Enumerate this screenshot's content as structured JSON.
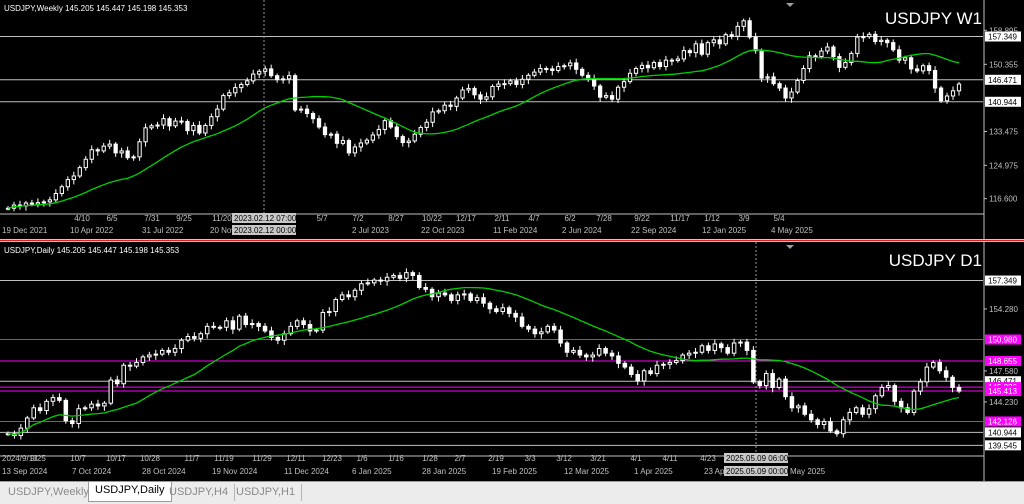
{
  "tabs": [
    "USDJPY,Weekly",
    "USDJPY,Daily",
    "USDJPY,H4",
    "USDJPY,H1"
  ],
  "active_tab": 1,
  "chart_data": [
    {
      "type": "candlestick",
      "panel": "weekly",
      "info": "USDJPY,Weekly  145.205 145.447 145.198 145.353",
      "title": "USDJPY W1",
      "ylim": [
        113.0,
        163.0
      ],
      "price_ticks": [
        "158.895",
        "150.355",
        "133.475",
        "124.975",
        "116.600"
      ],
      "levels": [
        {
          "label": "157.349",
          "price": 157.349,
          "color": "#c0c0c0"
        },
        {
          "label": "146.471",
          "price": 146.471,
          "color": "#c0c0c0"
        },
        {
          "label": "140.944",
          "price": 140.944,
          "color": "#c0c0c0"
        }
      ],
      "time_labels": [
        "4/10",
        "6/5",
        "7/31",
        "9/25",
        "11/20",
        "5/7",
        "7/2",
        "8/27",
        "10/22",
        "12/17",
        "2/11",
        "4/7",
        "6/2",
        "7/28",
        "9/22",
        "11/17",
        "1/12",
        "3/9",
        "5/4"
      ],
      "date_labels": [
        "19 Dec 2021",
        "10 Apr 2022",
        "31 Jul 2022",
        "20 Nov 2022",
        "2 Jul 2023",
        "22 Oct 2023",
        "11 Feb 2024",
        "2 Jun 2024",
        "22 Sep 2024",
        "12 Jan 2025",
        "4 May 2025"
      ],
      "crosshair_time": "2023.02.12 07:00",
      "crosshair_date": "2023.02.12 00:00",
      "series": [
        {
          "name": "",
          "values": [
            114.2,
            115.0,
            114.8,
            115.5,
            115.2,
            115.6,
            115.8,
            116.3,
            117.9,
            119.6,
            121.4,
            122.3,
            124.4,
            126.5,
            128.9,
            128.6,
            129.8,
            130.3,
            128.1,
            128.6,
            126.9,
            127.1,
            130.9,
            134.4,
            134.9,
            135.1,
            136.7,
            134.9,
            136.1,
            136.0,
            133.7,
            135.0,
            133.1,
            135.0,
            137.2,
            139.1,
            142.5,
            143.2,
            144.5,
            145.3,
            146.2,
            147.9,
            148.6,
            149.2,
            147.5,
            146.5,
            146.7,
            147.5,
            138.9,
            139.1,
            138.0,
            136.7,
            134.6,
            132.7,
            132.8,
            130.5,
            131.2,
            128.1,
            129.6,
            130.6,
            131.3,
            132.6,
            134.0,
            136.2,
            134.6,
            132.2,
            130.7,
            131.1,
            132.8,
            134.5,
            135.8,
            138.4,
            138.7,
            140.1,
            139.8,
            141.9,
            143.9,
            144.3,
            142.7,
            141.6,
            142.2,
            144.8,
            145.4,
            145.5,
            146.2,
            145.3,
            146.6,
            147.6,
            148.4,
            149.3,
            149.2,
            148.8,
            149.8,
            150.0,
            150.7,
            149.1,
            147.6,
            146.7,
            144.9,
            142.1,
            142.5,
            141.6,
            144.6,
            146.0,
            148.1,
            149.3,
            150.1,
            149.5,
            150.8,
            149.8,
            151.4,
            151.3,
            151.7,
            153.8,
            153.3,
            155.5,
            152.9,
            155.8,
            156.5,
            155.5,
            157.8,
            157.4,
            159.9,
            161.3,
            157.2,
            153.8,
            146.9,
            147.2,
            145.5,
            144.4,
            141.9,
            143.4,
            146.3,
            149.3,
            152.5,
            152.3,
            153.7,
            154.7,
            152.3,
            149.6,
            150.8,
            153.1,
            157.2,
            157.3,
            157.9,
            156.1,
            156.4,
            155.8,
            154.0,
            151.4,
            152.0,
            149.2,
            148.7,
            150.0,
            148.8,
            144.4,
            141.2,
            142.4,
            143.7,
            145.4
          ],
          "ma": 21
        }
      ]
    },
    {
      "type": "candlestick",
      "panel": "daily",
      "info": "USDJPY,Daily  145.205 145.447 145.198 145.353",
      "title": "USDJPY D1",
      "ylim": [
        138.5,
        160.0
      ],
      "price_ticks": [
        "154.280",
        "147.580",
        "144.230"
      ],
      "levels": [
        {
          "label": "157.349",
          "price": 157.349,
          "color": "#c0c0c0"
        },
        {
          "label": "150.980",
          "price": 150.98,
          "color": "#ff00ff"
        },
        {
          "label": "148.655",
          "price": 148.655,
          "color": "#ff00ff"
        },
        {
          "label": "146.471",
          "price": 146.471,
          "color": "#c0c0c0"
        },
        {
          "label": "145.836",
          "price": 145.836,
          "color": "#ff00ff"
        },
        {
          "label": "145.413",
          "price": 145.413,
          "color": "#ff00ff"
        },
        {
          "label": "142.126",
          "price": 142.126,
          "color": "#ff00ff"
        },
        {
          "label": "140.944",
          "price": 140.944,
          "color": "#c0c0c0"
        },
        {
          "label": "139.545",
          "price": 139.545,
          "color": "#c0c0c0"
        }
      ],
      "time_labels": [
        "9/25",
        "10/7",
        "10/17",
        "10/28",
        "11/7",
        "11/19",
        "11/29",
        "12/11",
        "12/23",
        "1/6",
        "1/16",
        "1/28",
        "2/7",
        "2/19",
        "3/3",
        "3/12",
        "3/21",
        "4/1",
        "4/11",
        "4/23"
      ],
      "first_time_label": "2024/9/13",
      "date_labels": [
        "13 Sep 2024",
        "7 Oct 2024",
        "28 Oct 2024",
        "19 Nov 2024",
        "11 Dec 2024",
        "6 Jan 2025",
        "28 Jan 2025",
        "19 Feb 2025",
        "12 Mar 2025",
        "1 Apr 2025",
        "23 Apr 2025",
        "May 2025"
      ],
      "crosshair_time": "2025.05.09 06:00",
      "crosshair_date": "2025.05.09 00:00",
      "series": [
        {
          "name": "",
          "values": [
            140.8,
            140.6,
            141.4,
            142.5,
            143.6,
            143.3,
            144.3,
            144.7,
            144.4,
            142.2,
            141.9,
            143.5,
            143.6,
            144.0,
            143.8,
            144.1,
            146.6,
            146.2,
            148.2,
            148.1,
            148.5,
            149.1,
            149.3,
            149.4,
            149.8,
            149.6,
            150.0,
            150.9,
            151.3,
            151.1,
            151.6,
            152.4,
            152.3,
            152.3,
            153.0,
            152.1,
            153.5,
            152.6,
            152.7,
            152.4,
            151.9,
            151.2,
            150.9,
            151.6,
            152.4,
            153.0,
            152.6,
            151.9,
            152.0,
            153.9,
            154.0,
            155.3,
            155.8,
            155.6,
            156.3,
            157.0,
            157.1,
            157.4,
            157.3,
            157.7,
            157.9,
            157.6,
            158.2,
            157.9,
            156.6,
            156.4,
            155.6,
            156.0,
            155.8,
            155.2,
            155.8,
            155.9,
            155.2,
            155.5,
            154.9,
            154.3,
            154.0,
            154.4,
            153.8,
            153.4,
            152.4,
            152.1,
            151.6,
            151.8,
            152.4,
            152.0,
            150.6,
            149.6,
            149.8,
            149.3,
            149.1,
            149.3,
            150.0,
            149.5,
            149.2,
            148.4,
            148.0,
            147.2,
            146.5,
            147.6,
            147.3,
            148.2,
            148.3,
            148.5,
            148.7,
            149.3,
            149.5,
            149.6,
            150.3,
            149.8,
            150.5,
            150.1,
            149.5,
            150.6,
            150.7,
            149.8,
            146.4,
            146.0,
            147.3,
            145.8,
            146.7,
            144.8,
            143.6,
            143.8,
            142.9,
            142.3,
            141.8,
            142.1,
            141.1,
            140.8,
            142.3,
            143.1,
            143.6,
            142.9,
            143.5,
            144.9,
            145.8,
            146.0,
            144.3,
            143.6,
            143.1,
            145.4,
            146.4,
            148.0,
            148.5,
            147.6,
            146.9,
            145.8,
            145.4
          ],
          "ma": 21
        }
      ]
    }
  ]
}
